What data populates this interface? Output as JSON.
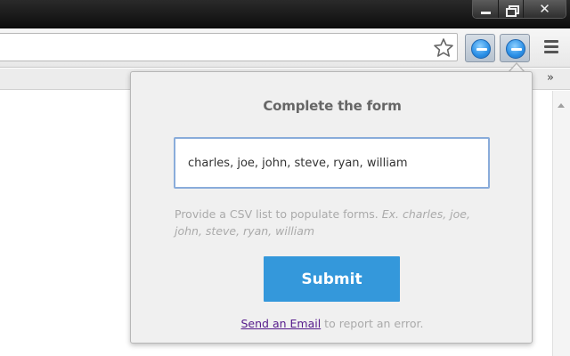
{
  "window": {
    "controls": {
      "minimize_icon": "minimize-icon",
      "restore_icon": "restore-icon",
      "close_icon": "close-icon",
      "close_glyph": "✕"
    }
  },
  "toolbar": {
    "bookmark_icon": "star-outline-icon",
    "extension_icons": [
      "blue-extension-icon",
      "blue-extension-icon"
    ],
    "menu_icon": "hamburger-menu-icon",
    "overflow_glyph": "»"
  },
  "popup": {
    "title": "Complete the form",
    "input_value": "charles, joe, john, steve, ryan, william",
    "help_text": "Provide a CSV list to populate forms. ",
    "help_example": "Ex. charles, joe, john, steve, ryan, william",
    "submit_label": "Submit",
    "footer_link": "Send an Email",
    "footer_text": " to report an error.",
    "colors": {
      "submit_bg": "#3498db",
      "input_border": "#89acda",
      "link": "#551a8b"
    }
  }
}
